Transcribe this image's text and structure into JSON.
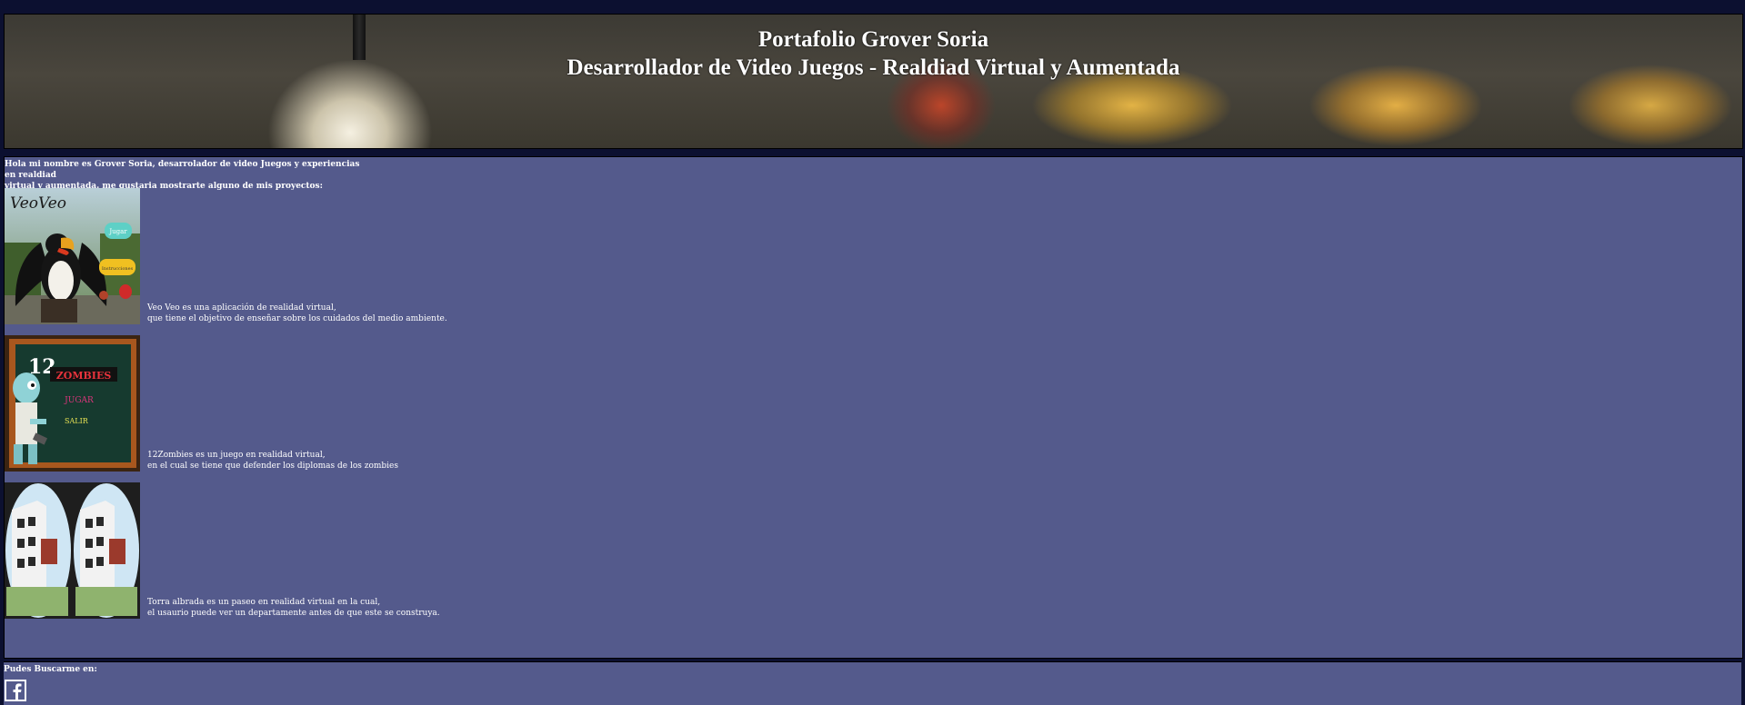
{
  "header": {
    "title_line1": "Portafolio Grover Soria",
    "title_line2": "Desarrollador de Video Juegos - Realdiad Virtual y Aumentada"
  },
  "intro": {
    "line1": "Hola mi nombre es Grover Soria, desarrolador de video Juegos y experiencias en realdiad",
    "line2": "virtual y aumentada. me gustaria mostrarte alguno de mis proyectos:"
  },
  "projects": [
    {
      "desc_line1": "Veo Veo es una aplicación de realidad virtual,",
      "desc_line2": "que tiene el objetivo de enseñar sobre los cuidados del medio ambiente.",
      "thumb_logo": "VeoVeo",
      "thumb_btn1": "Jugar",
      "thumb_btn2": "Instrucciones"
    },
    {
      "desc_line1": "12Zombies es un juego en realidad virtual,",
      "desc_line2": "en el cual se tiene que defender los diplomas de los zombies",
      "thumb_title_num": "12",
      "thumb_title_word": "ZOMBIES",
      "thumb_menu1": "JUGAR",
      "thumb_menu2": "SALIR"
    },
    {
      "desc_line1": "Torra albrada es un paseo en realidad virtual en la cual,",
      "desc_line2": "el usaurio puede ver un departamente antes de que este se construya."
    }
  ],
  "footer": {
    "label": "Pudes Buscarme en:",
    "facebook_glyph": "f"
  },
  "colors": {
    "page_bg": "#0c1030",
    "panel_bg": "#545a8c",
    "text": "#ffffff"
  },
  "icons": [
    "facebook-icon"
  ]
}
